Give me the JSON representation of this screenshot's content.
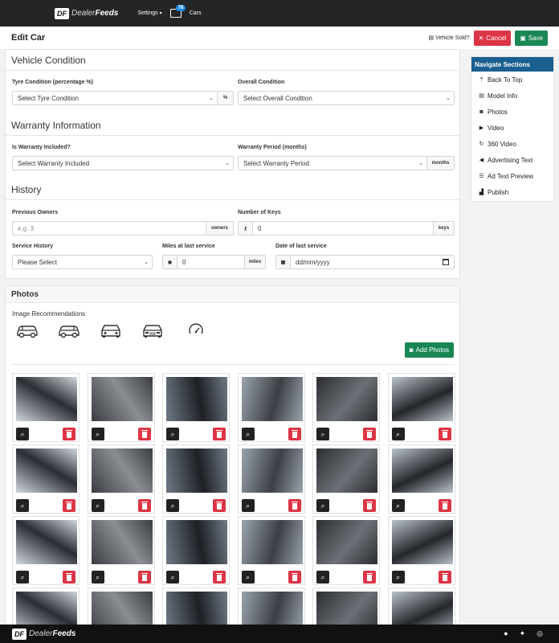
{
  "topbar": {
    "logo_mark": "DF",
    "logo_word_1": "Dealer",
    "logo_word_2": "Feeds",
    "settings_label": "Settings",
    "cars_badge": "78",
    "cars_label": "Cars"
  },
  "header": {
    "title": "Edit Car",
    "sold_label": "Vehicle Sold?",
    "cancel_label": "Cancel",
    "save_label": "Save"
  },
  "condition": {
    "title": "Vehicle Condition",
    "tyre_label": "Tyre Condition (percentage %)",
    "tyre_value": "Select Tyre Condition",
    "tyre_addon": "%",
    "overall_label": "Overall Condition",
    "overall_value": "Select Overall Condition"
  },
  "warranty": {
    "title": "Warranty Information",
    "included_label": "Is Warranty Included?",
    "included_value": "Select Warranty Included",
    "period_label": "Warranty Period (months)",
    "period_value": "Select Warranty Period",
    "period_addon": "months"
  },
  "history": {
    "title": "History",
    "owners_label": "Previous Owners",
    "owners_placeholder": "e.g. 3",
    "owners_addon": "owners",
    "keys_label": "Number of Keys",
    "keys_value": "0",
    "keys_addon": "keys",
    "service_label": "Service History",
    "service_value": "Please Select",
    "miles_label": "Miles at last service",
    "miles_value": "0",
    "miles_addon": "miles",
    "date_label": "Date of last service",
    "date_value": "dd/mm/yyyy"
  },
  "photos": {
    "title": "Photos",
    "recommendations_label": "Image Recommendations",
    "add_label": "Add Photos"
  },
  "sidebar": {
    "title": "Navigate Sections",
    "items": [
      {
        "label": "Back To Top",
        "icon": "arrow-up-icon"
      },
      {
        "label": "Model Info",
        "icon": "car-info-icon"
      },
      {
        "label": "Photos",
        "icon": "camera-icon"
      },
      {
        "label": "Video",
        "icon": "video-icon"
      },
      {
        "label": "360 Video",
        "icon": "360-icon"
      },
      {
        "label": "Advertising Text",
        "icon": "megaphone-icon"
      },
      {
        "label": "Ad Text Preview",
        "icon": "list-icon"
      },
      {
        "label": "Publish",
        "icon": "stamp-icon"
      }
    ]
  },
  "footer": {
    "logo_mark": "DF",
    "logo_word_1": "Dealer",
    "logo_word_2": "Feeds"
  },
  "colors": {
    "topbar": "#232526",
    "sidebar_head": "#1a5f8f",
    "danger": "#dc3545",
    "success": "#198754"
  }
}
